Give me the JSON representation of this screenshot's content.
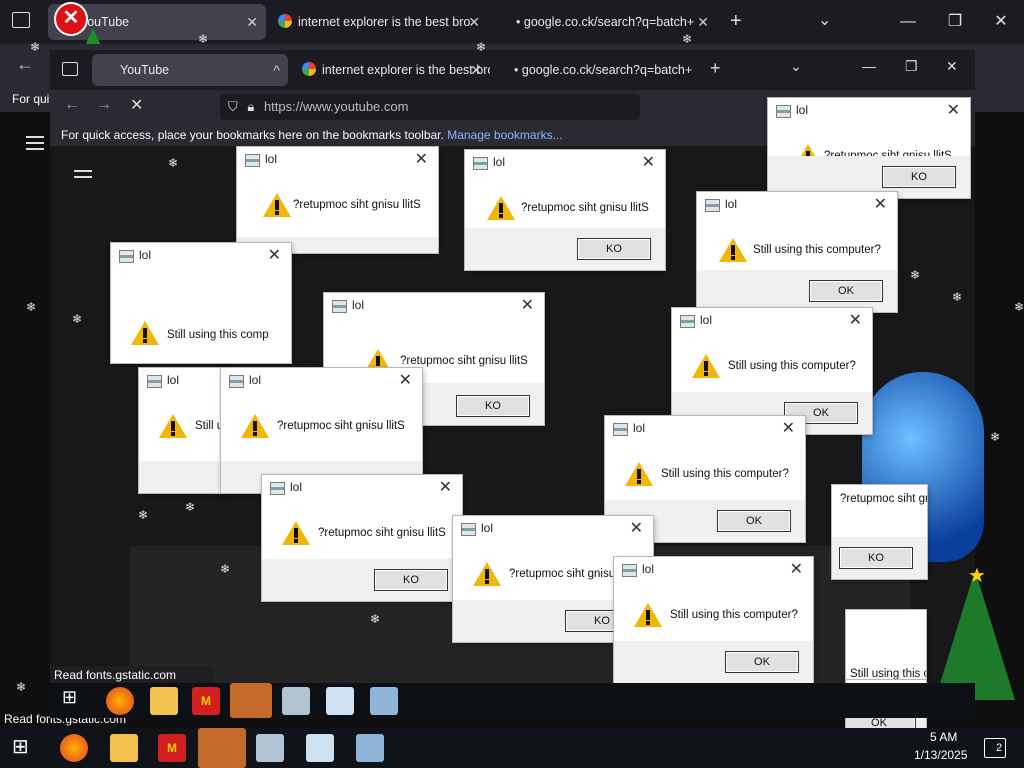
{
  "browser_back": {
    "tabs": [
      {
        "label": "YouTube"
      },
      {
        "label": "internet explorer is the best bro"
      },
      {
        "label": "google.co.ck/search?q=batch+"
      }
    ],
    "new_tab": "+",
    "bookmarks_hint": "For qui",
    "status_text": "Read fonts.gstatic.com"
  },
  "browser_front": {
    "tabs": [
      {
        "label": "YouTube"
      },
      {
        "label": "internet explorer is the best bro"
      },
      {
        "label": "google.co.ck/search?q=batch+"
      }
    ],
    "url": "https://www.youtube.com",
    "bookmarks_text": "For quick access, place your bookmarks here on the bookmarks toolbar.",
    "bookmarks_link": "Manage bookmarks...",
    "status_text": "Read fonts.gstatic.com"
  },
  "dialogs": [
    {
      "title": "lol",
      "message": "?retupmoc siht gnisu llitS",
      "button": "KO"
    },
    {
      "title": "lol",
      "message": "Still using this computer?",
      "button": "OK"
    },
    {
      "title": "lol",
      "message": "Still using this comp",
      "button": "OK"
    },
    {
      "title": "lol",
      "message": "Still u",
      "button": "OK"
    },
    {
      "title": "lol",
      "message": "?retupmoc siht gnisu llitS",
      "button": "KO"
    },
    {
      "title": "lol",
      "message": "?retupmoc siht gnisu llitS",
      "button": "KO"
    },
    {
      "title": "lol",
      "message": "Still using this computer?",
      "button": "OK"
    },
    {
      "title": "lol",
      "message": "Still using this computer?",
      "button": "OK"
    },
    {
      "title": "lol",
      "message": "?retupmoc siht gnisu llitS",
      "button": "KO"
    },
    {
      "title": "lol",
      "message": "Still using this computer?",
      "button": "OK"
    },
    {
      "title": "lol",
      "message": "?retupmoc siht gnisu llitS",
      "button": "KO"
    },
    {
      "title": "lol",
      "message": "?retupmoc siht gnisu llitS",
      "button": "KO"
    },
    {
      "title": "lol",
      "message": "Still using this computer?",
      "button": "OK"
    },
    {
      "title": "lol",
      "message": "Still using this computer?",
      "button": "OK"
    }
  ],
  "clock": {
    "time": "5 AM",
    "date": "1/13/2025"
  },
  "notifications": {
    "count": "2"
  },
  "colors": {
    "warning": "#f2b705",
    "dialog_bg": "#ffffff",
    "taskbar": "#101418"
  }
}
